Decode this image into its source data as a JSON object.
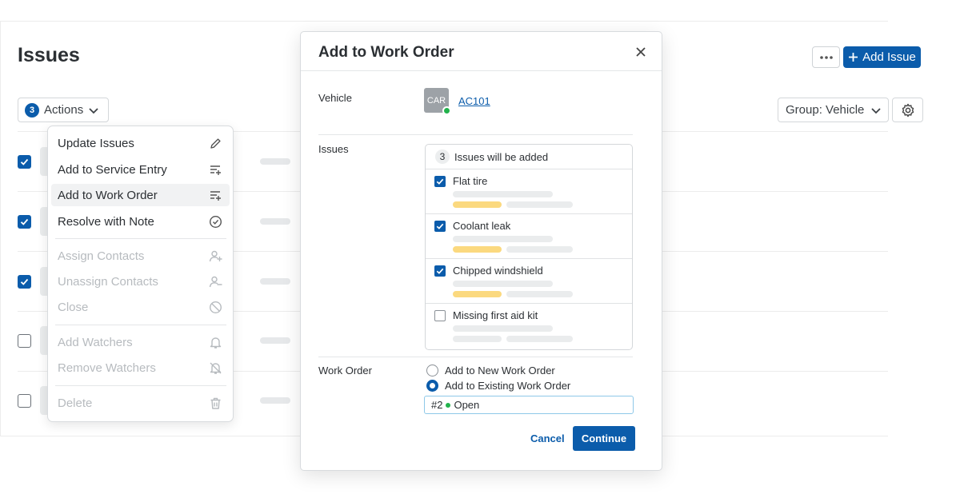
{
  "page": {
    "title": "Issues",
    "actions_button": {
      "count": "3",
      "label": "Actions"
    },
    "add_issue_label": "Add Issue",
    "group_label": "Group: Vehicle",
    "rows": [
      {
        "checked": true
      },
      {
        "checked": true
      },
      {
        "checked": true
      },
      {
        "checked": false
      },
      {
        "checked": false
      }
    ]
  },
  "actions_menu": {
    "items": [
      {
        "label": "Update Issues",
        "icon": "pencil-icon",
        "enabled": true
      },
      {
        "label": "Add to Service Entry",
        "icon": "list-add-icon",
        "enabled": true
      },
      {
        "label": "Add to Work Order",
        "icon": "list-add-icon",
        "enabled": true,
        "highlighted": true
      },
      {
        "label": "Resolve with Note",
        "icon": "check-circle-icon",
        "enabled": true
      },
      {
        "label": "Assign Contacts",
        "icon": "user-add-icon",
        "enabled": false
      },
      {
        "label": "Unassign Contacts",
        "icon": "user-remove-icon",
        "enabled": false
      },
      {
        "label": "Close",
        "icon": "ban-icon",
        "enabled": false
      },
      {
        "label": "Add Watchers",
        "icon": "bell-icon",
        "enabled": false
      },
      {
        "label": "Remove Watchers",
        "icon": "bell-off-icon",
        "enabled": false
      },
      {
        "label": "Delete",
        "icon": "trash-icon",
        "enabled": false
      }
    ]
  },
  "modal": {
    "title": "Add to Work Order",
    "vehicle_label": "Vehicle",
    "vehicle": {
      "thumb_text": "CAR",
      "name": "AC101",
      "status_color": "#22b24c"
    },
    "issues_label": "Issues",
    "issues_summary": {
      "count": "3",
      "text": "Issues will be added"
    },
    "issues": [
      {
        "name": "Flat tire",
        "checked": true
      },
      {
        "name": "Coolant leak",
        "checked": true
      },
      {
        "name": "Chipped windshield",
        "checked": true
      },
      {
        "name": "Missing first aid kit",
        "checked": false
      }
    ],
    "work_order_label": "Work Order",
    "options": [
      {
        "label": "Add to New Work Order",
        "selected": false
      },
      {
        "label": "Add to Existing Work Order",
        "selected": true
      }
    ],
    "selected_work_order": {
      "number": "#2",
      "status": "Open"
    },
    "cancel_label": "Cancel",
    "continue_label": "Continue"
  },
  "colors": {
    "primary": "#0b5cab",
    "status_green": "#22b24c",
    "skeleton_yellow": "#fbd97f"
  }
}
